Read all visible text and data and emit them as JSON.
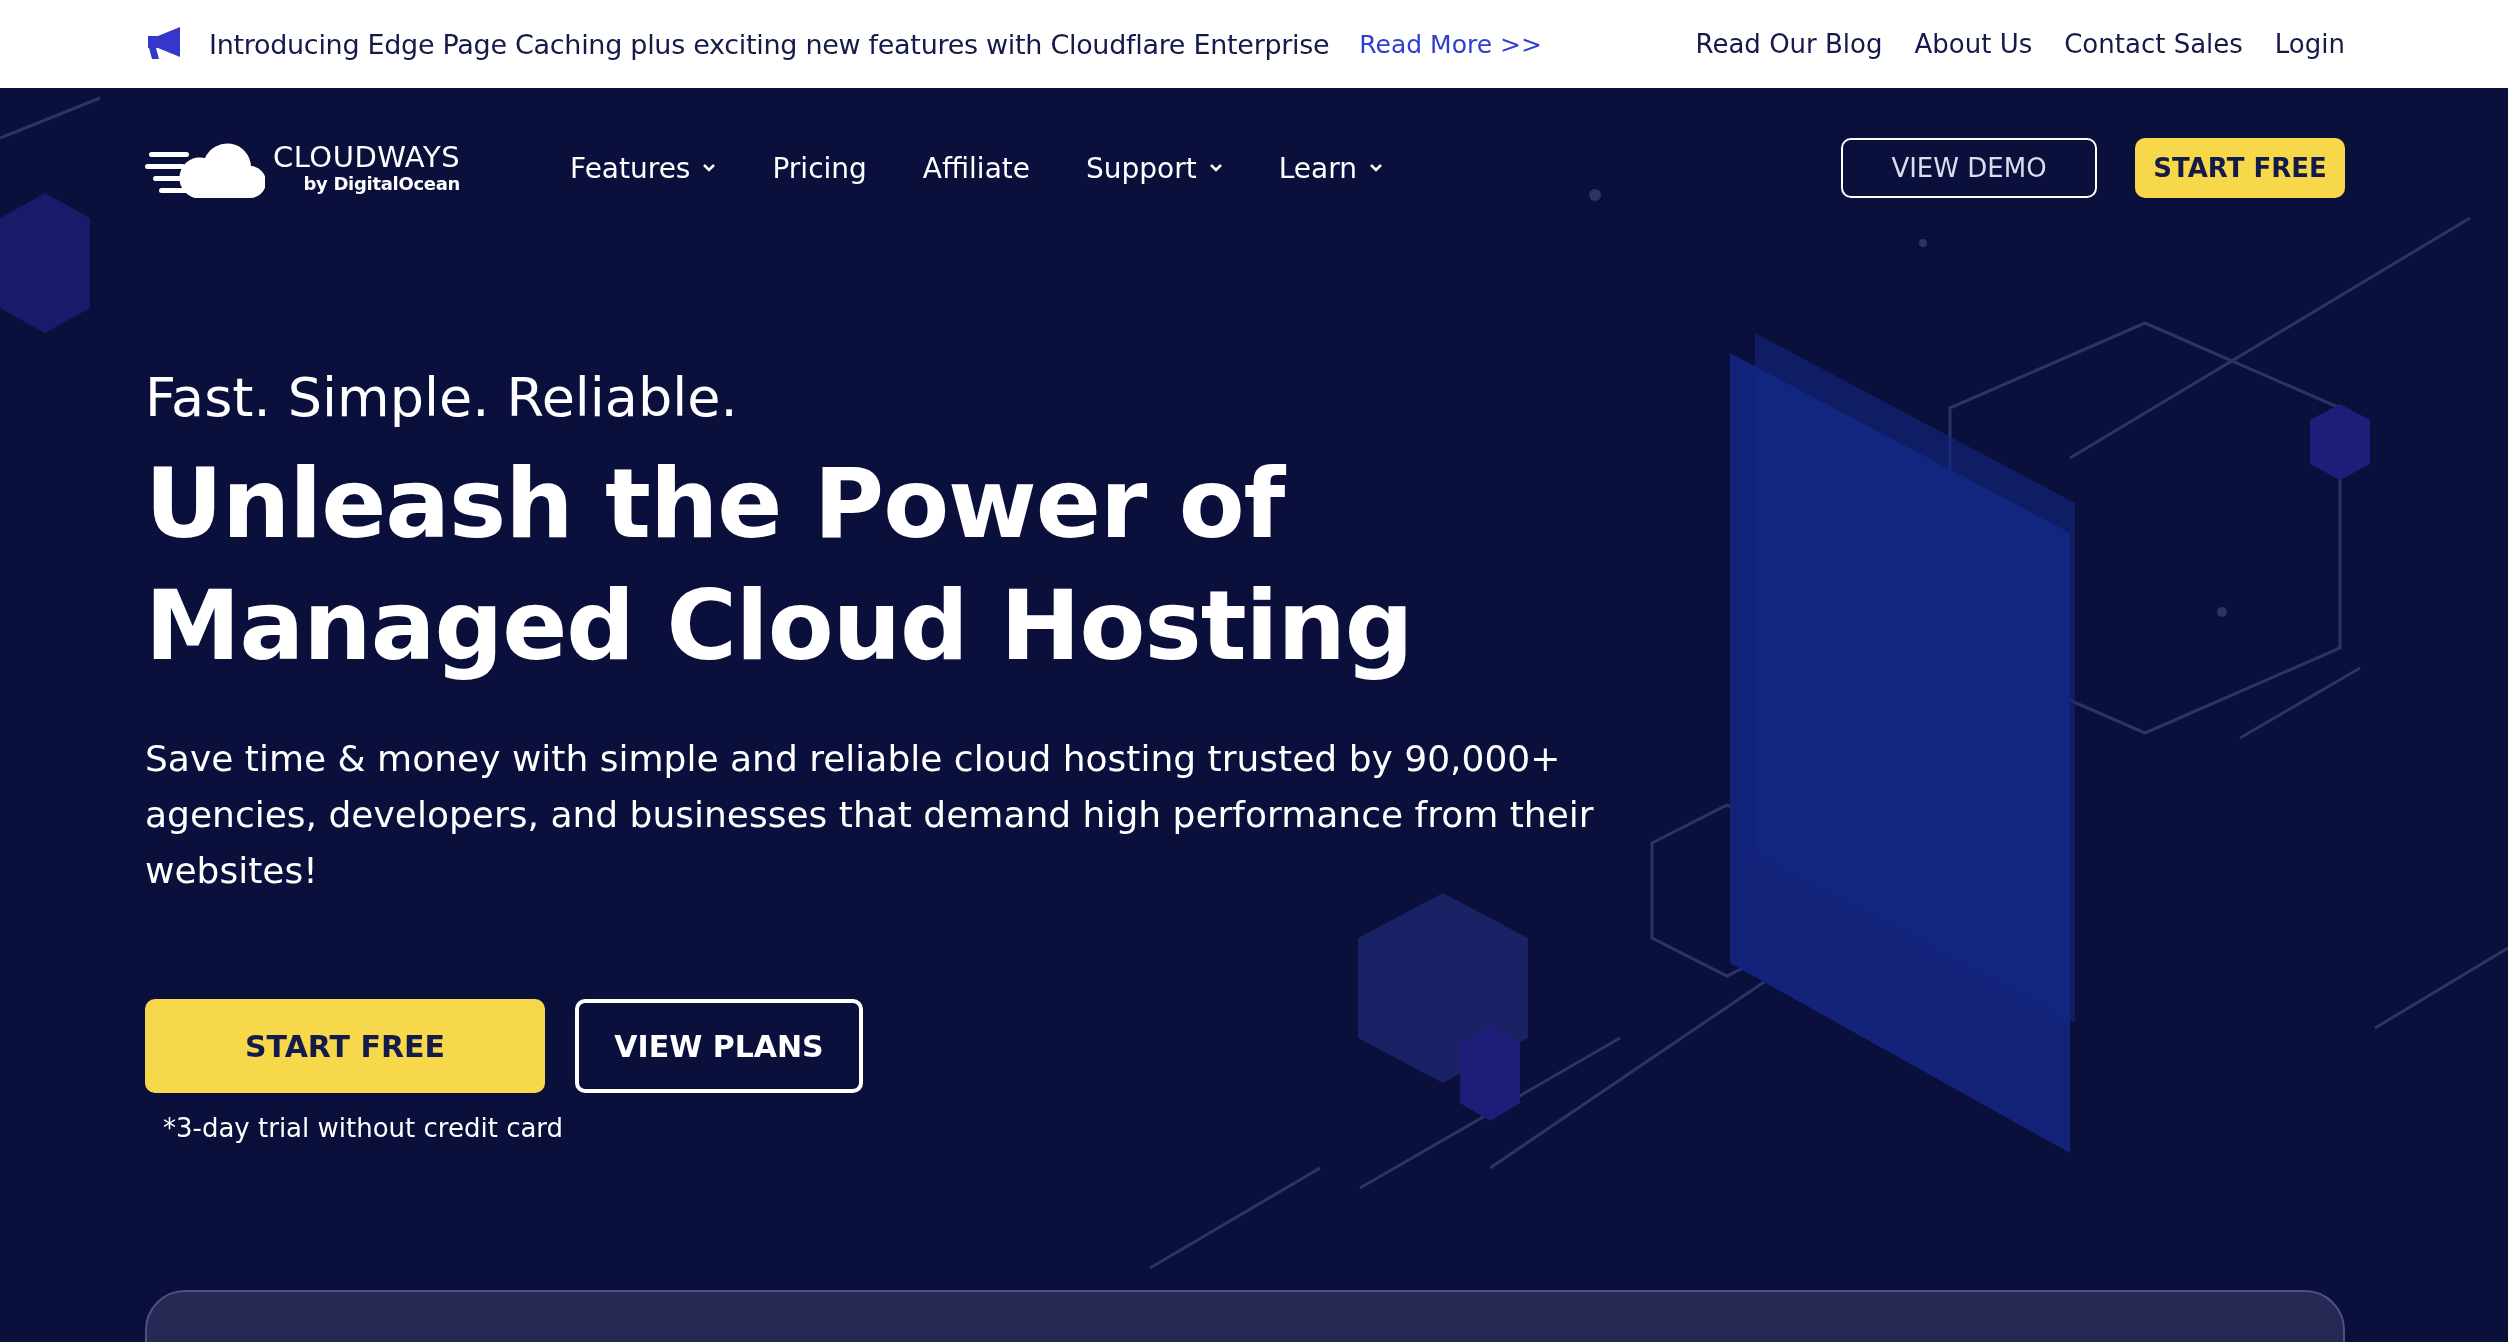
{
  "announcement": {
    "text": "Introducing Edge Page Caching plus exciting new features with Cloudflare Enterprise",
    "link": "Read More >>"
  },
  "top_links": [
    "Read Our Blog",
    "About Us",
    "Contact Sales",
    "Login"
  ],
  "logo": {
    "name": "CLOUDWAYS",
    "byline": "by DigitalOcean"
  },
  "nav": [
    {
      "label": "Features",
      "has_menu": true
    },
    {
      "label": "Pricing",
      "has_menu": false
    },
    {
      "label": "Affiliate",
      "has_menu": false
    },
    {
      "label": "Support",
      "has_menu": true
    },
    {
      "label": "Learn",
      "has_menu": true
    }
  ],
  "nav_buttons": [
    {
      "label": "VIEW DEMO",
      "kind": "outline"
    },
    {
      "label": "START FREE",
      "kind": "filled"
    }
  ],
  "hero": {
    "tagline": "Fast. Simple. Reliable.",
    "headline": [
      "Unleash the Power of",
      "Managed Cloud Hosting"
    ],
    "description": "Save time & money with simple and reliable cloud hosting trusted by 90,000+ agencies, developers, and businesses that demand high performance from their websites!",
    "buttons": [
      {
        "label": "START FREE",
        "kind": "filled"
      },
      {
        "label": "VIEW PLANS",
        "kind": "outline"
      }
    ],
    "note": "*3-day trial without credit card"
  }
}
